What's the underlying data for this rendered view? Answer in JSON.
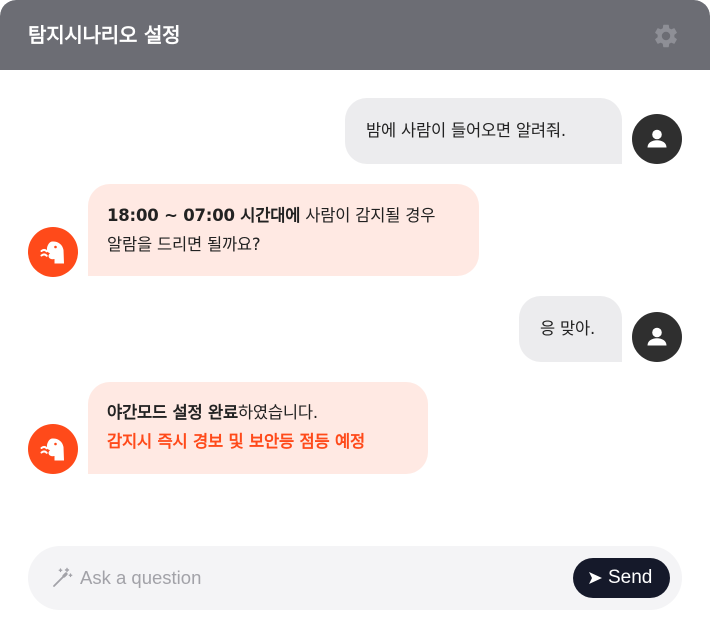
{
  "header": {
    "title": "탐지시나리오 설정",
    "settings_icon": "gear-icon"
  },
  "messages": [
    {
      "role": "user",
      "text": "밤에 사람이 들어오면 알려줘."
    },
    {
      "role": "bot",
      "bold": "18:00 ~ 07:00 시간대에",
      "text": " 사람이 감지될 경우",
      "line2": "알람을 드리면 될까요?"
    },
    {
      "role": "user",
      "text": "응 맞아."
    },
    {
      "role": "bot",
      "bold": "야간모드 설정 완료",
      "text": "하였습니다.",
      "accent": "감지시 즉시 경보 및 보안등 점등 예정"
    }
  ],
  "input": {
    "placeholder": "Ask a question",
    "value": "",
    "icon": "magic-wand-icon"
  },
  "send": {
    "label": "Send",
    "icon": "send-arrow-icon"
  },
  "colors": {
    "header_bg": "#6c6d74",
    "bot_bubble": "#ffe9e3",
    "user_bubble": "#ececee",
    "accent": "#ff4a1a",
    "send_bg": "#15192a"
  }
}
